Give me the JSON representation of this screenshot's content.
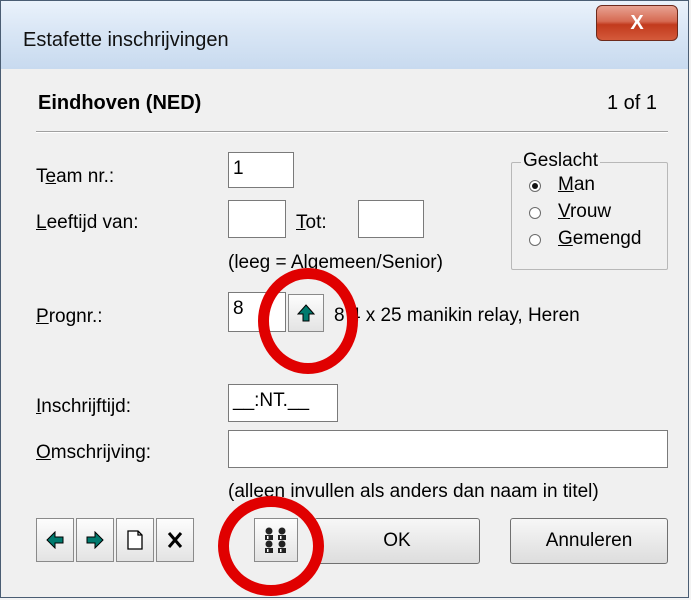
{
  "window": {
    "title": "Estafette inschrijvingen",
    "close_glyph": "X"
  },
  "header": {
    "name": "Eindhoven (NED)",
    "count": "1 of 1"
  },
  "form": {
    "team_label_pre": "T",
    "team_label_ul": "e",
    "team_label_post": "am nr.:",
    "team_value": "1",
    "age_label_ul": "L",
    "age_label_post": "eeftijd van:",
    "age_from_value": "",
    "tot_label_ul": "T",
    "tot_label_post": "ot:",
    "age_to_value": "",
    "age_hint": "(leeg = Algemeen/Senior)",
    "prog_label_ul": "P",
    "prog_label_post": "rognr.:",
    "prog_value": "8",
    "prog_desc": "8 4 x 25 manikin relay, Heren",
    "entry_time_label_ul": "I",
    "entry_time_label_post": "nschrijftijd:",
    "entry_time_value": "__:NT.__",
    "desc_label_ul": "O",
    "desc_label_post": "mschrijving:",
    "desc_value": "",
    "desc_hint": "(alleen invullen als anders dan naam in titel)"
  },
  "gender": {
    "title": "Geslacht",
    "options": [
      {
        "ul": "M",
        "rest": "an",
        "checked": true
      },
      {
        "ul": "V",
        "rest": "rouw",
        "checked": false
      },
      {
        "ul": "G",
        "rest": "emengd",
        "checked": false
      }
    ]
  },
  "toolbar": {
    "ok_label": "OK",
    "cancel_label": "Annuleren"
  },
  "colors": {
    "accent_arrow": "#007a6e",
    "annotation_circle": "#e00000"
  }
}
